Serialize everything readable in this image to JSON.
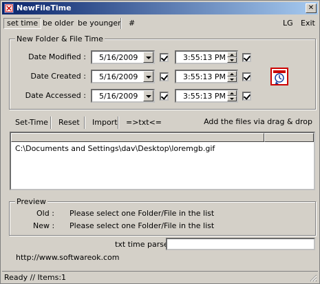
{
  "window": {
    "title": "NewFileTime",
    "close_label": "✕"
  },
  "menu": {
    "items": [
      "set time",
      "be older",
      "be younger",
      "#"
    ],
    "right": [
      "LG",
      "Exit"
    ]
  },
  "group_time": {
    "label": "New Folder & File Time",
    "rows": [
      {
        "label": "Date Modified :",
        "date": "5/16/2009",
        "time": "3:55:13 PM"
      },
      {
        "label": "Date Created :",
        "date": "5/16/2009",
        "time": "3:55:13 PM"
      },
      {
        "label": "Date Accessed :",
        "date": "5/16/2009",
        "time": "3:55:13 PM"
      }
    ],
    "apply_icon": "clock-calendar-icon"
  },
  "toolbar": {
    "set_time": "Set-Time",
    "reset": "Reset",
    "import": "Import",
    "txt": "=>txt<=",
    "hint": "Add the files via drag & drop"
  },
  "list": {
    "items": [
      "C:\\Documents and Settings\\dav\\Desktop\\loremgb.gif"
    ]
  },
  "preview": {
    "label": "Preview",
    "old_label": "Old :",
    "old_value": "Please select one Folder/File in the list",
    "new_label": "New :",
    "new_value": "Please select one Folder/File in the list"
  },
  "parser": {
    "label": "txt time parser :",
    "value": ""
  },
  "website": "http://www.softwareok.com",
  "status": "Ready // Items:1"
}
